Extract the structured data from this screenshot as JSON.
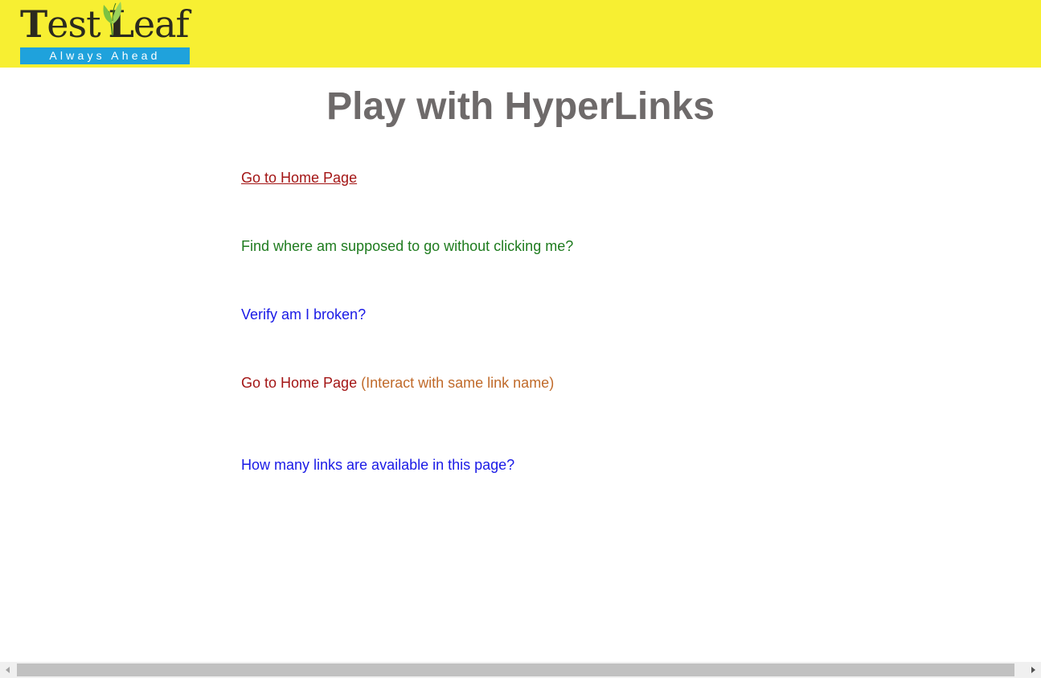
{
  "header": {
    "logo": {
      "word": "TestLeaf",
      "tagline": "Always Ahead",
      "leaf_icon": "leaf-icon",
      "colors": {
        "background": "#f7ef32",
        "tagline_bg": "#1fa2dc",
        "leaf": "#7cc242"
      }
    }
  },
  "page": {
    "title": "Play with HyperLinks"
  },
  "links": [
    {
      "label": "Go to Home Page",
      "color": "#a31515"
    },
    {
      "label": "Find where am supposed to go without clicking me?",
      "color": "#1e7b1e"
    },
    {
      "label": "Verify am I broken?",
      "color": "#1a1ae6"
    },
    {
      "label": "Go to Home Page",
      "note": "(Interact with same link name)",
      "color": "#a31515",
      "note_color": "#c06a2a"
    },
    {
      "label": "How many links are available in this page?",
      "color": "#1a1ae6"
    }
  ],
  "scrollbar": {
    "left_icon": "arrow-left-icon",
    "right_icon": "arrow-right-icon"
  }
}
